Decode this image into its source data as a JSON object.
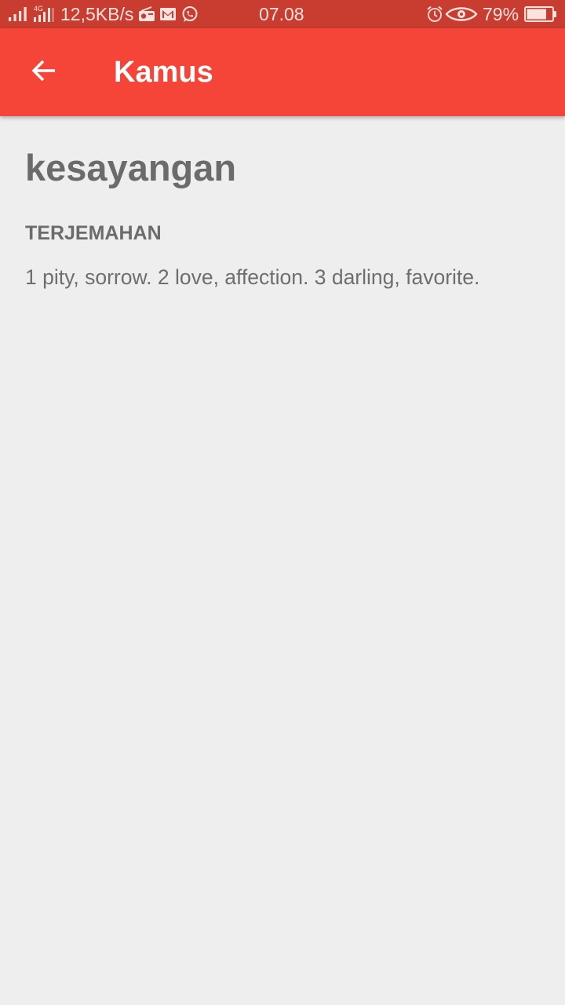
{
  "status_bar": {
    "network_type": "4G",
    "speed": "12,5KB/s",
    "time": "07.08",
    "battery_percent": "79%",
    "battery_level": 0.79,
    "icons": [
      "signal-icon",
      "signal-4g-icon",
      "radio-icon",
      "gmail-icon",
      "whatsapp-icon",
      "alarm-icon",
      "eye-icon",
      "battery-icon"
    ]
  },
  "app_bar": {
    "title": "Kamus",
    "back_icon": "arrow-back-icon",
    "background_color": "#f44538"
  },
  "entry": {
    "word": "kesayangan",
    "section_label": "TERJEMAHAN",
    "translation": "1 pity, sorrow. 2 love, affection. 3 darling, favorite."
  },
  "colors": {
    "status_bar": "#c93c30",
    "app_bar": "#f44538",
    "background": "#eeeeee",
    "text": "#6b6b6b"
  }
}
